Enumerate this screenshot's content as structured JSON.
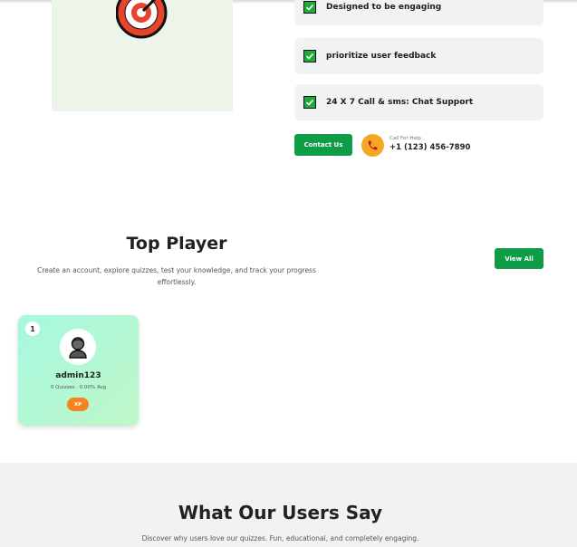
{
  "hero": {
    "image_icon": "target-dart-icon"
  },
  "features": [
    {
      "text": "Designed to be engaging",
      "icon": "checkbox-checked-icon"
    },
    {
      "text": "prioritize user feedback",
      "icon": "checkbox-checked-icon"
    },
    {
      "text": "24 X 7 Call & sms: Chat Support",
      "icon": "checkbox-checked-icon"
    }
  ],
  "contact": {
    "button_label": "Contact Us",
    "call_label": "Call For Help",
    "phone_number": "+1 (123) 456-7890",
    "icon": "phone-icon"
  },
  "top_player": {
    "title": "Top Player",
    "description": "Create an account, explore quizzes, test your knowledge, and track your progress effortlessly.",
    "view_all_label": "View All",
    "players": [
      {
        "rank": "1",
        "name": "admin123",
        "stats": "0 Quizzes · 0.00% Avg",
        "badge": "XP",
        "avatar_icon": "user-avatar-icon"
      }
    ]
  },
  "testimonials": {
    "title": "What Our Users Say",
    "description": "Discover why users love our quizzes. Fun, educational, and completely engaging."
  },
  "colors": {
    "primary_green": "#0e9c47",
    "check_green": "#1faa3b",
    "orange": "#f5a623",
    "xp_orange": "#f5841f",
    "card_bg": "#f1f2f4",
    "player_card_gradient_start": "#a6f8e0",
    "player_card_gradient_end": "#bff7c8"
  }
}
